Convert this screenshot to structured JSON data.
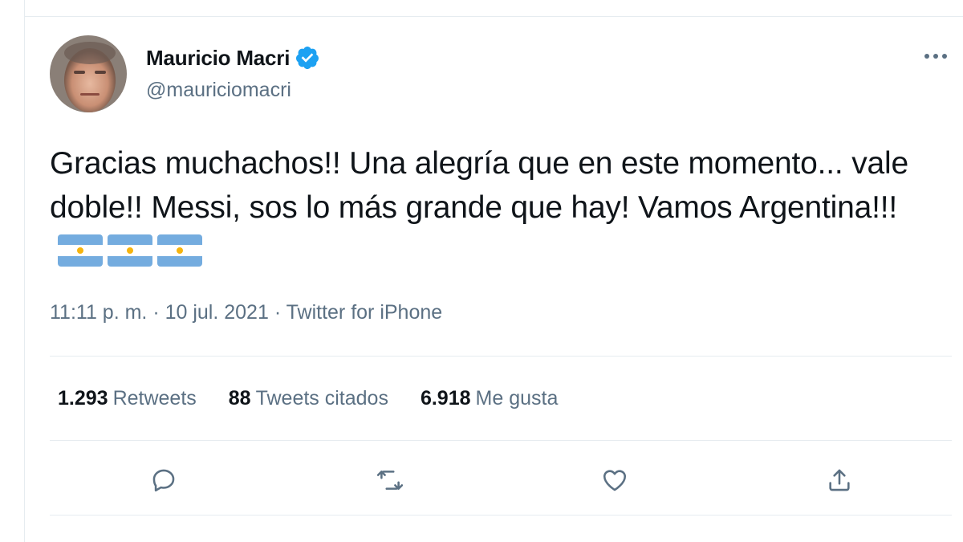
{
  "author": {
    "display_name": "Mauricio Macri",
    "handle": "@mauriciomacri",
    "verified_icon": "verified-badge-icon"
  },
  "tweet": {
    "text": "Gracias muchachos!! Una alegría que en este momento... vale doble!! Messi, sos lo más grande que hay! Vamos Argentina!!!",
    "flags": [
      "argentina-flag-emoji",
      "argentina-flag-emoji",
      "argentina-flag-emoji"
    ],
    "time": "11:11 p. m.",
    "separator": " · ",
    "date": "10 jul. 2021",
    "source": "Twitter for iPhone"
  },
  "stats": {
    "retweets_count": "1.293",
    "retweets_label": "Retweets",
    "quotes_count": "88",
    "quotes_label": "Tweets citados",
    "likes_count": "6.918",
    "likes_label": "Me gusta"
  },
  "actions": [
    "reply-icon",
    "retweet-icon",
    "like-icon",
    "share-icon"
  ],
  "colors": {
    "text": "#0f1419",
    "secondary": "#5b7083",
    "border": "#e6ecf0",
    "verified": "#1da1f2",
    "flag_blue": "#74acdf",
    "flag_sun": "#f6b40e"
  }
}
